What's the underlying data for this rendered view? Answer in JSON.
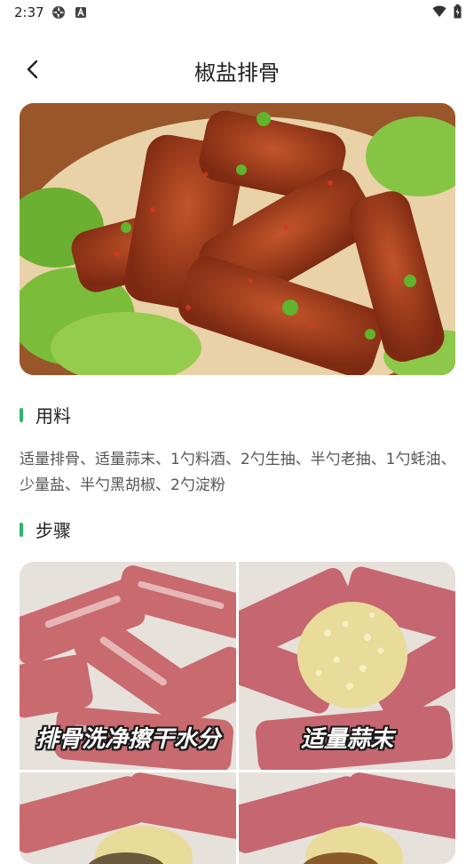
{
  "status_bar": {
    "time": "2:37",
    "left_icons": [
      "aperture-icon",
      "a-box-icon"
    ],
    "right_icons": [
      "wifi-icon",
      "battery-icon"
    ]
  },
  "header": {
    "back_icon": "chevron-left-icon",
    "title": "椒盐排骨"
  },
  "ingredients": {
    "title": "用料",
    "text": "适量排骨、适量蒜末、1勺料酒、2勺生抽、半勺老抽、1勺蚝油、少量盐、半勺黑胡椒、2勺淀粉"
  },
  "steps": {
    "title": "步骤",
    "captions": [
      "排骨洗净擦干水分",
      "适量蒜末"
    ]
  },
  "colors": {
    "accent": "#2db56a",
    "title_text": "#222222",
    "body_text": "#555555"
  }
}
